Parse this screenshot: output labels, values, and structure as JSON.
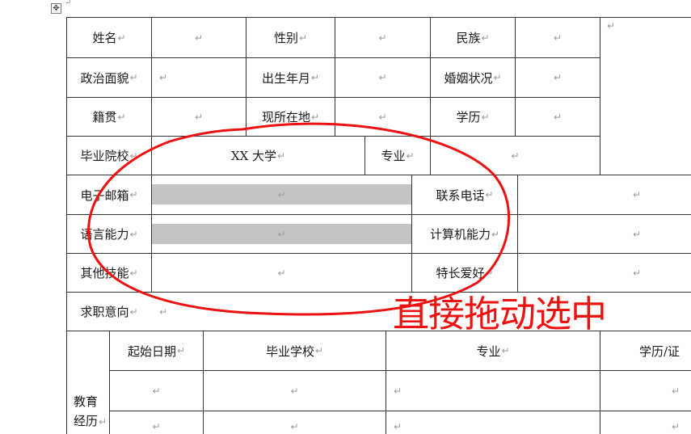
{
  "para_mark": "↵",
  "move_handle_glyph": "✥",
  "row1": {
    "name_label": "姓名",
    "gender_label": "性别",
    "ethnicity_label": "民族"
  },
  "row2": {
    "politics_label": "政治面貌",
    "birth_label": "出生年月",
    "marital_label": "婚姻状况"
  },
  "row3": {
    "origin_label": "籍贯",
    "location_label": "现所在地",
    "degree_label": "学历"
  },
  "row4": {
    "school_label": "毕业院校",
    "school_value": "XX 大学",
    "major_label": "专业"
  },
  "row5": {
    "email_label": "电子邮箱",
    "phone_label": "联系电话"
  },
  "row6": {
    "language_label": "语言能力",
    "computer_label": "计算机能力"
  },
  "row7": {
    "skills_label": "其他技能",
    "hobby_label": "特长爱好"
  },
  "row8": {
    "intent_label": "求职意向"
  },
  "education": {
    "section_label_line1": "教育",
    "section_label_line2": "经历",
    "col_start": "起始日期",
    "col_school": "毕业学校",
    "col_major": "专业",
    "col_degree": "学历/证"
  },
  "annotation": {
    "text": "直接拖动选中",
    "color": "#ee1111"
  },
  "colors": {
    "shade": "#c4c4c4",
    "border": "#333333",
    "mark": "#9a9a9a"
  }
}
